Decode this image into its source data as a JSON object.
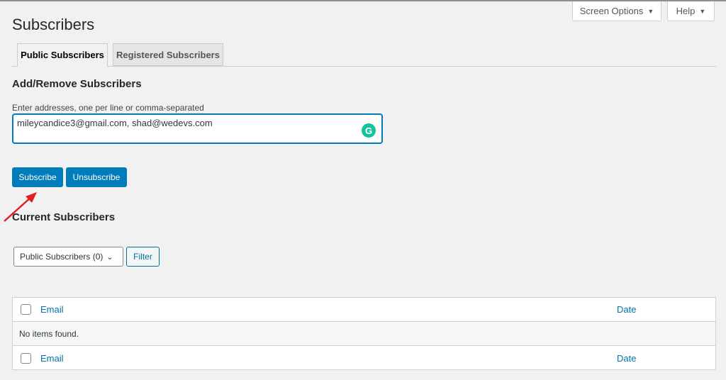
{
  "header": {
    "screen_options": "Screen Options",
    "help": "Help",
    "page_title": "Subscribers"
  },
  "tabs": [
    {
      "label": "Public Subscribers",
      "active": true
    },
    {
      "label": "Registered Subscribers",
      "active": false
    }
  ],
  "form": {
    "heading": "Add/Remove Subscribers",
    "label": "Enter addresses, one per line or comma-separated",
    "value": "mileycandice3@gmail.com, shad@wedevs.com",
    "grammarly_icon": "G",
    "subscribe": "Subscribe",
    "unsubscribe": "Unsubscribe"
  },
  "current": {
    "heading": "Current Subscribers",
    "select_value": "Public Subscribers (0)",
    "filter": "Filter"
  },
  "table": {
    "columns": [
      "Email",
      "Date"
    ],
    "empty": "No items found."
  },
  "colors": {
    "accent": "#007cba",
    "annotation_arrow": "#e02020"
  }
}
